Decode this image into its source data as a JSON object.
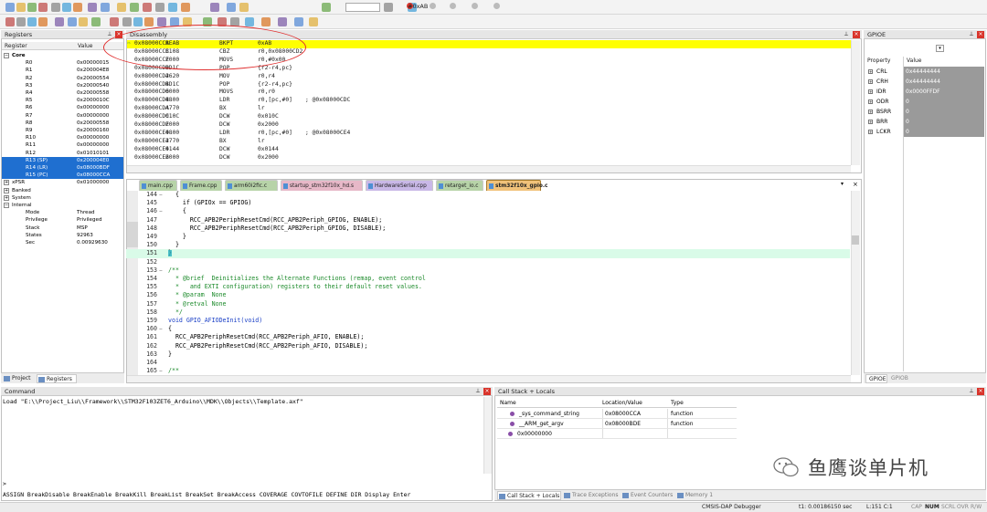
{
  "toolbar": {
    "address_value": "#0xAB"
  },
  "registers_panel": {
    "title": "Registers",
    "col_register": "Register",
    "col_value": "Value",
    "groups": [
      {
        "name": "Core",
        "sign": "−",
        "bold": true
      },
      {
        "name": "xPSR",
        "sign": "+",
        "value": "0x01000000"
      },
      {
        "name": "Banked",
        "sign": "+"
      },
      {
        "name": "System",
        "sign": "+"
      },
      {
        "name": "Internal",
        "sign": "−"
      }
    ],
    "core": [
      {
        "name": "R0",
        "value": "0x00000015"
      },
      {
        "name": "R1",
        "value": "0x200004E8"
      },
      {
        "name": "R2",
        "value": "0x20000554"
      },
      {
        "name": "R3",
        "value": "0x20000540"
      },
      {
        "name": "R4",
        "value": "0x20000558"
      },
      {
        "name": "R5",
        "value": "0x2000010C"
      },
      {
        "name": "R6",
        "value": "0x00000000"
      },
      {
        "name": "R7",
        "value": "0x00000000"
      },
      {
        "name": "R8",
        "value": "0x20000558"
      },
      {
        "name": "R9",
        "value": "0x20000160"
      },
      {
        "name": "R10",
        "value": "0x00000000"
      },
      {
        "name": "R11",
        "value": "0x00000000"
      },
      {
        "name": "R12",
        "value": "0x01010101"
      },
      {
        "name": "R13 (SP)",
        "value": "0x200004E0"
      },
      {
        "name": "R14 (LR)",
        "value": "0x08000BDF"
      },
      {
        "name": "R15 (PC)",
        "value": "0x08000CCA"
      }
    ],
    "internal": [
      {
        "name": "Mode",
        "value": "Thread"
      },
      {
        "name": "Privilege",
        "value": "Privileged"
      },
      {
        "name": "Stack",
        "value": "MSP"
      },
      {
        "name": "States",
        "value": "92963"
      },
      {
        "name": "Sec",
        "value": "0.00929630"
      }
    ],
    "tabs": [
      "Project",
      "Registers"
    ]
  },
  "disassembly": {
    "title": "Disassembly",
    "lines": [
      {
        "addr": "0x08000CCA",
        "code": "BEAB",
        "op": "BKPT",
        "args": "0xAB",
        "comment": ""
      },
      {
        "addr": "0x08000CCC",
        "code": "B108",
        "op": "CBZ",
        "args": "r0,0x08000CD2",
        "comment": ""
      },
      {
        "addr": "0x08000CCE",
        "code": "2000",
        "op": "MOVS",
        "args": "r0,#0x00",
        "comment": ""
      },
      {
        "addr": "0x08000CD0",
        "code": "BD1C",
        "op": "POP",
        "args": "{r2-r4,pc}",
        "comment": ""
      },
      {
        "addr": "0x08000CD2",
        "code": "4620",
        "op": "MOV",
        "args": "r0,r4",
        "comment": ""
      },
      {
        "addr": "0x08000CD4",
        "code": "BD1C",
        "op": "POP",
        "args": "{r2-r4,pc}",
        "comment": ""
      },
      {
        "addr": "0x08000CD6",
        "code": "0000",
        "op": "MOVS",
        "args": "r0,r0",
        "comment": ""
      },
      {
        "addr": "0x08000CD8",
        "code": "4800",
        "op": "LDR",
        "args": "r0,[pc,#0]",
        "comment": "; @0x08000CDC"
      },
      {
        "addr": "0x08000CDA",
        "code": "4770",
        "op": "BX",
        "args": "lr",
        "comment": ""
      },
      {
        "addr": "0x08000CDC",
        "code": "010C",
        "op": "DCW",
        "args": "0x010C",
        "comment": ""
      },
      {
        "addr": "0x08000CDE",
        "code": "2000",
        "op": "DCW",
        "args": "0x2000",
        "comment": ""
      },
      {
        "addr": "0x08000CE0",
        "code": "4800",
        "op": "LDR",
        "args": "r0,[pc,#0]",
        "comment": "; @0x08000CE4"
      },
      {
        "addr": "0x08000CE2",
        "code": "4770",
        "op": "BX",
        "args": "lr",
        "comment": ""
      },
      {
        "addr": "0x08000CE4",
        "code": "0144",
        "op": "DCW",
        "args": "0x0144",
        "comment": ""
      },
      {
        "addr": "0x08000CE6",
        "code": "2000",
        "op": "DCW",
        "args": "0x2000",
        "comment": ""
      }
    ]
  },
  "editor": {
    "tabs": [
      {
        "label": "main.cpp",
        "color": "#b7d3a8"
      },
      {
        "label": "Frame.cpp",
        "color": "#b7d3a8"
      },
      {
        "label": "arm60i2fic.c",
        "color": "#b7d3a8"
      },
      {
        "label": "startup_stm32f10x_hd.s",
        "color": "#e7b8c8"
      },
      {
        "label": "HardwareSerial.cpp",
        "color": "#c9b8e7"
      },
      {
        "label": "retarget_io.c",
        "color": "#b7d3a8"
      },
      {
        "label": "stm32f10x_gpio.c",
        "color": "#f1c27a"
      }
    ],
    "lines": [
      {
        "num": "144",
        "fold": "−",
        "text": "  {",
        "cls": ""
      },
      {
        "num": "145",
        "fold": "",
        "text": "    if (GPIOx == GPIOG)",
        "cls": ""
      },
      {
        "num": "146",
        "fold": "−",
        "text": "    {",
        "cls": ""
      },
      {
        "num": "147",
        "fold": "",
        "text": "      RCC_APB2PeriphResetCmd(RCC_APB2Periph_GPIOG, ENABLE);",
        "cls": ""
      },
      {
        "num": "148",
        "fold": "",
        "text": "      RCC_APB2PeriphResetCmd(RCC_APB2Periph_GPIOG, DISABLE);",
        "cls": ""
      },
      {
        "num": "149",
        "fold": "",
        "text": "    }",
        "cls": ""
      },
      {
        "num": "150",
        "fold": "",
        "text": "  }",
        "cls": ""
      },
      {
        "num": "151",
        "fold": "",
        "text": "}",
        "cls": "cur"
      },
      {
        "num": "152",
        "fold": "",
        "text": "",
        "cls": ""
      },
      {
        "num": "153",
        "fold": "−",
        "text": "/**",
        "cls": "cm"
      },
      {
        "num": "154",
        "fold": "",
        "text": "  * @brief  Deinitializes the Alternate Functions (remap, event control",
        "cls": "cm"
      },
      {
        "num": "155",
        "fold": "",
        "text": "  *   and EXTI configuration) registers to their default reset values.",
        "cls": "cm"
      },
      {
        "num": "156",
        "fold": "",
        "text": "  * @param  None",
        "cls": "cm"
      },
      {
        "num": "157",
        "fold": "",
        "text": "  * @retval None",
        "cls": "cm"
      },
      {
        "num": "158",
        "fold": "",
        "text": "  */",
        "cls": "cm"
      },
      {
        "num": "159",
        "fold": "",
        "text": "void GPIO_AFIODeInit(void)",
        "cls": "kw"
      },
      {
        "num": "160",
        "fold": "−",
        "text": "{",
        "cls": ""
      },
      {
        "num": "161",
        "fold": "",
        "text": "  RCC_APB2PeriphResetCmd(RCC_APB2Periph_AFIO, ENABLE);",
        "cls": ""
      },
      {
        "num": "162",
        "fold": "",
        "text": "  RCC_APB2PeriphResetCmd(RCC_APB2Periph_AFIO, DISABLE);",
        "cls": ""
      },
      {
        "num": "163",
        "fold": "",
        "text": "}",
        "cls": ""
      },
      {
        "num": "164",
        "fold": "",
        "text": "",
        "cls": ""
      },
      {
        "num": "165",
        "fold": "−",
        "text": "/**",
        "cls": "cm"
      }
    ]
  },
  "gpio": {
    "title": "GPIOE",
    "col_property": "Property",
    "col_value": "Value",
    "rows": [
      {
        "name": "CRL",
        "value": "0x44444444"
      },
      {
        "name": "CRH",
        "value": "0x44444444"
      },
      {
        "name": "IDR",
        "value": "0x0000FFDF"
      },
      {
        "name": "ODR",
        "value": "0"
      },
      {
        "name": "BSRR",
        "value": "0"
      },
      {
        "name": "BRR",
        "value": "0"
      },
      {
        "name": "LCKR",
        "value": "0"
      }
    ],
    "tabs": [
      "GPIOE",
      "GPIOB"
    ]
  },
  "command": {
    "title": "Command",
    "output": "Load \"E:\\\\Project_Liu\\\\Framework\\\\STM32F103ZET6_Arduino\\\\MDK\\\\Objects\\\\Template.axf\"",
    "prompt": ">",
    "hints": "ASSIGN BreakDisable BreakEnable BreakKill BreakList BreakSet BreakAccess COVERAGE COVTOFILE DEFINE DIR Display Enter"
  },
  "callstack": {
    "title": "Call Stack + Locals",
    "col_name": "Name",
    "col_location": "Location/Value",
    "col_type": "Type",
    "rows": [
      {
        "name": "_sys_command_string",
        "location": "0x08000CCA",
        "type": "function"
      },
      {
        "name": "__ARM_get_argv",
        "location": "0x08000BDE",
        "type": "function"
      },
      {
        "name": "0x00000000",
        "location": "",
        "type": ""
      }
    ],
    "tabs": [
      "Call Stack + Locals",
      "Trace Exceptions",
      "Event Counters",
      "Memory 1"
    ]
  },
  "watermark": {
    "text": "鱼鹰谈单片机"
  },
  "status": {
    "debugger": "CMSIS-DAP Debugger",
    "time": "t1: 0.00186150 sec",
    "position": "L:151 C:1",
    "caps": "CAP",
    "num": "NUM",
    "scrl": "SCRL",
    "ovr": "OVR",
    "rw": "R/W"
  },
  "colors": {
    "highlight_yellow": "#ffff00",
    "annotation_red": "#e03030",
    "selection_blue": "#1f6fd0",
    "current_line": "#d9fbe8"
  }
}
